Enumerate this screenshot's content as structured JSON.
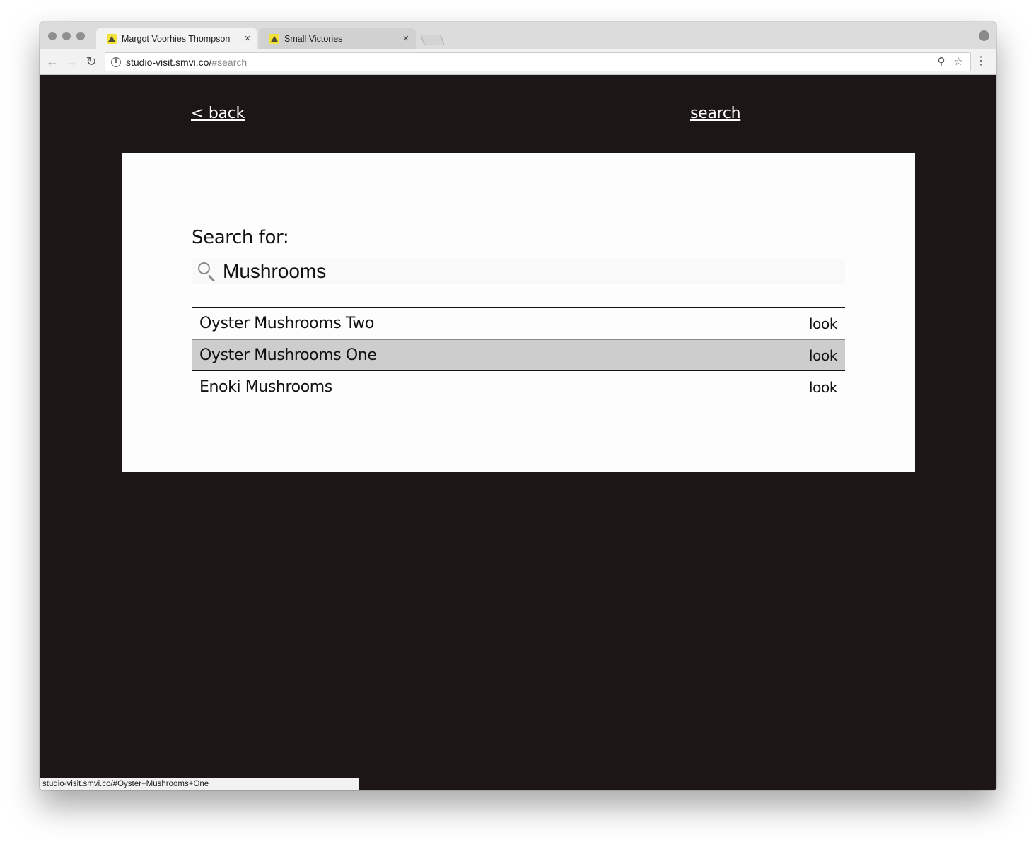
{
  "browser": {
    "tabs": [
      {
        "title": "Margot Voorhies Thompson",
        "close": "×"
      },
      {
        "title": "Small Victories",
        "close": "×"
      }
    ],
    "nav": {
      "back": "←",
      "forward": "→",
      "reload": "↻"
    },
    "url_host": "studio-visit.smvi.co/",
    "url_path": "#search",
    "info_glyph": "i",
    "zoom_glyph": "⚲",
    "star_glyph": "☆",
    "menu_glyph": "⋮",
    "status_url": "studio-visit.smvi.co/#Oyster+Mushrooms+One"
  },
  "page": {
    "back_link": "< back",
    "search_link": "search",
    "search_label": "Search for:",
    "search_value": "Mushrooms",
    "results": [
      {
        "title": "Oyster Mushrooms Two",
        "action": "look",
        "highlighted": false
      },
      {
        "title": "Oyster Mushrooms One",
        "action": "look",
        "highlighted": true
      },
      {
        "title": "Enoki Mushrooms",
        "action": "look",
        "highlighted": false
      }
    ]
  },
  "colors": {
    "page_background": "#1c1616",
    "panel_background": "#fdfdfd",
    "highlight_row": "#cdcdcd",
    "favicon": "#f3e23a"
  }
}
